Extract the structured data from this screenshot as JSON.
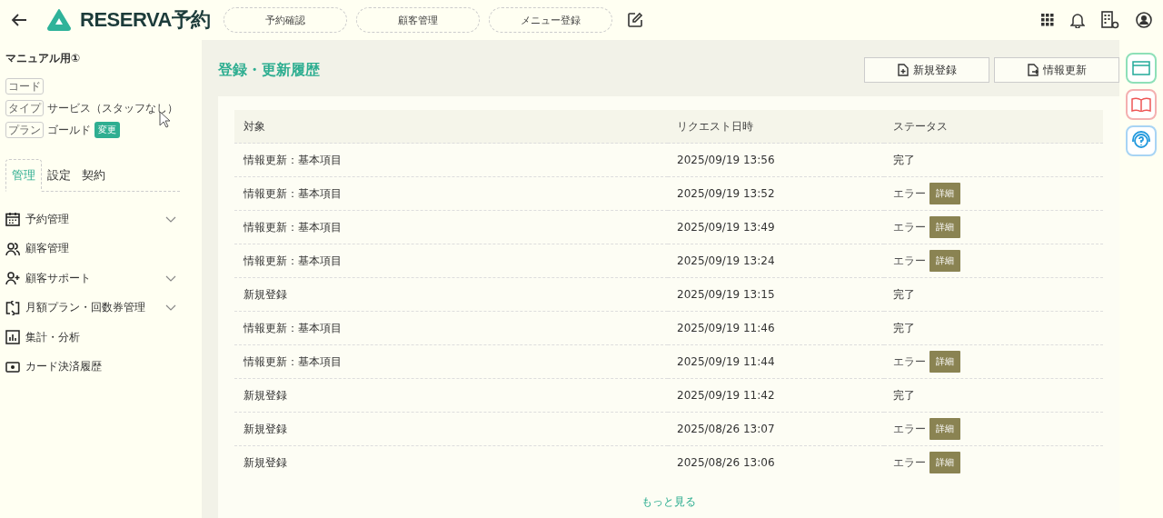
{
  "header": {
    "logo": "RESERVA予約",
    "nav": [
      "予約確認",
      "顧客管理",
      "メニュー登録"
    ]
  },
  "sidebar": {
    "shop_name": "マニュアル用①",
    "info": [
      {
        "tag": "コード"
      },
      {
        "tag": "タイプ",
        "value": "サービス（スタッフなし）"
      },
      {
        "tag": "プラン",
        "value": "ゴールド",
        "badge": "変更"
      }
    ],
    "tabs": [
      {
        "label": "管理",
        "selected": true
      },
      {
        "label": "設定",
        "selected": false
      },
      {
        "label": "契約",
        "selected": false
      }
    ],
    "items": [
      {
        "label": "予約管理",
        "expandable": true
      },
      {
        "label": "顧客管理",
        "expandable": false
      },
      {
        "label": "顧客サポート",
        "expandable": true
      },
      {
        "label": "月額プラン・回数券管理",
        "expandable": true
      },
      {
        "label": "集計・分析",
        "expandable": false
      },
      {
        "label": "カード決済履歴",
        "expandable": false
      }
    ]
  },
  "page": {
    "title": "登録・更新履歴",
    "buttons": [
      "新規登録",
      "情報更新"
    ]
  },
  "table": {
    "columns": [
      "対象",
      "リクエスト日時",
      "ステータス"
    ],
    "rows": [
      {
        "target": "情報更新：基本項目",
        "datetime": "2025/09/19 13:56",
        "status": "完了",
        "kind": "done"
      },
      {
        "target": "情報更新：基本項目",
        "datetime": "2025/09/19 13:52",
        "status": "エラー",
        "kind": "error",
        "detail": "詳細"
      },
      {
        "target": "情報更新：基本項目",
        "datetime": "2025/09/19 13:49",
        "status": "エラー",
        "kind": "error",
        "detail": "詳細"
      },
      {
        "target": "情報更新：基本項目",
        "datetime": "2025/09/19 13:24",
        "status": "エラー",
        "kind": "error",
        "detail": "詳細"
      },
      {
        "target": "新規登録",
        "datetime": "2025/09/19 13:15",
        "status": "完了",
        "kind": "done"
      },
      {
        "target": "情報更新：基本項目",
        "datetime": "2025/09/19 11:46",
        "status": "完了",
        "kind": "done"
      },
      {
        "target": "情報更新：基本項目",
        "datetime": "2025/09/19 11:44",
        "status": "エラー",
        "kind": "error",
        "detail": "詳細"
      },
      {
        "target": "新規登録",
        "datetime": "2025/09/19 11:42",
        "status": "完了",
        "kind": "done"
      },
      {
        "target": "新規登録",
        "datetime": "2025/08/26 13:07",
        "status": "エラー",
        "kind": "error",
        "detail": "詳細"
      },
      {
        "target": "新規登録",
        "datetime": "2025/08/26 13:06",
        "status": "エラー",
        "kind": "error",
        "detail": "詳細"
      }
    ],
    "more": "もっと見る"
  }
}
